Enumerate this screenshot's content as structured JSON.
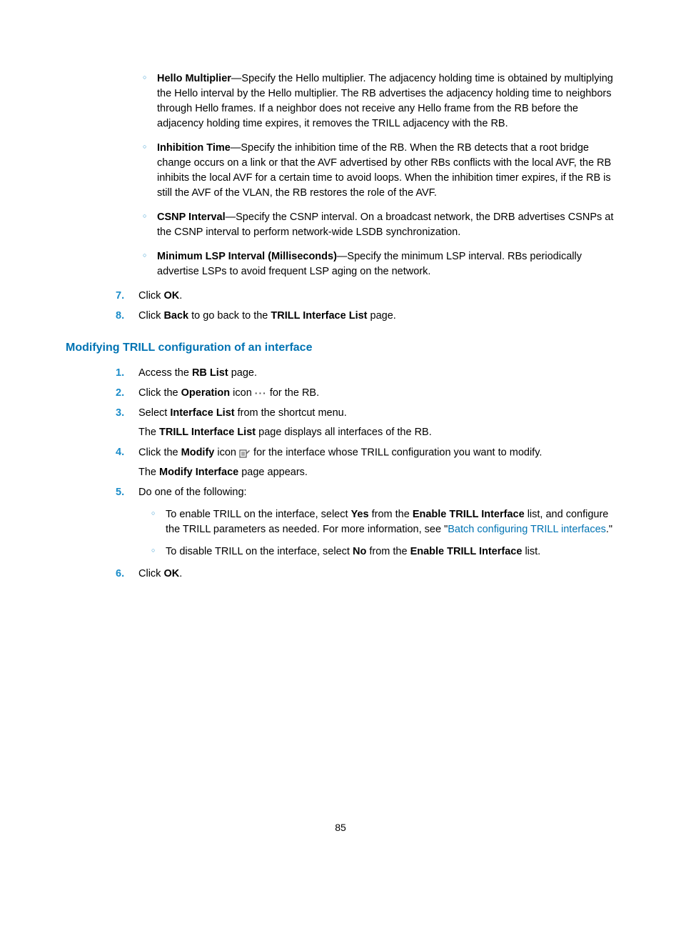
{
  "topBullets": [
    {
      "term": "Hello Multiplier",
      "text": "—Specify the Hello multiplier. The adjacency holding time is obtained by multiplying the Hello interval by the Hello multiplier. The RB advertises the adjacency holding time to neighbors through Hello frames. If a neighbor does not receive any Hello frame from the RB before the adjacency holding time expires, it removes the TRILL adjacency with the RB."
    },
    {
      "term": "Inhibition Time",
      "text": "—Specify the inhibition time of the RB. When the RB detects that a root bridge change occurs on a link or that the AVF advertised by other RBs conflicts with the local AVF, the RB inhibits the local AVF for a certain time to avoid loops. When the inhibition timer expires, if the RB is still the AVF of the VLAN, the RB restores the role of the AVF."
    },
    {
      "term": "CSNP Interval",
      "text": "—Specify the CSNP interval. On a broadcast network, the DRB advertises CSNPs at the CSNP interval to perform network-wide LSDB synchronization."
    },
    {
      "term": "Minimum LSP Interval (Milliseconds)",
      "text": "—Specify the minimum LSP interval. RBs periodically advertise LSPs to avoid frequent LSP aging on the network."
    }
  ],
  "topSteps": {
    "s7": {
      "num": "7.",
      "pre": "Click ",
      "bold1": "OK",
      "post": "."
    },
    "s8": {
      "num": "8.",
      "pre": "Click ",
      "bold1": "Back",
      "mid": " to go back to the ",
      "bold2": "TRILL Interface List",
      "post": " page."
    }
  },
  "sectionHeading": "Modifying TRILL configuration of an interface",
  "steps": {
    "s1": {
      "num": "1.",
      "pre": "Access the ",
      "bold1": "RB List",
      "post": " page."
    },
    "s2": {
      "num": "2.",
      "pre": "Click the ",
      "bold1": "Operation",
      "mid": " icon ",
      "post": " for the RB."
    },
    "s3": {
      "num": "3.",
      "pre": "Select ",
      "bold1": "Interface List",
      "post": " from the shortcut menu.",
      "line2pre": "The ",
      "line2bold": "TRILL Interface List",
      "line2post": " page displays all interfaces of the RB."
    },
    "s4": {
      "num": "4.",
      "pre": "Click the ",
      "bold1": "Modify",
      "mid": " icon ",
      "post": " for the interface whose TRILL configuration you want to modify.",
      "line2pre": "The ",
      "line2bold": "Modify Interface",
      "line2post": " page appears."
    },
    "s5": {
      "num": "5.",
      "text": "Do one of the following:",
      "sub1": {
        "pre": "To enable TRILL on the interface, select ",
        "bold1": "Yes",
        "mid": " from the ",
        "bold2": "Enable TRILL Interface",
        "mid2": " list, and configure the TRILL parameters as needed. For more information, see \"",
        "link": "Batch configuring TRILL interfaces",
        "post": ".\""
      },
      "sub2": {
        "pre": "To disable TRILL on the interface, select ",
        "bold1": "No",
        "mid": " from the ",
        "bold2": "Enable TRILL Interface",
        "post": " list."
      }
    },
    "s6": {
      "num": "6.",
      "pre": "Click ",
      "bold1": "OK",
      "post": "."
    }
  },
  "pageNumber": "85"
}
